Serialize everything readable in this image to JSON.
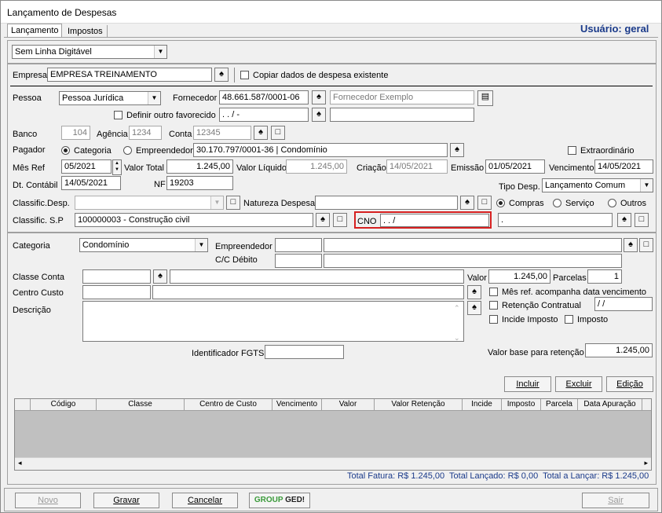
{
  "window": {
    "title": "Lançamento de Despesas"
  },
  "tabs": [
    {
      "label": "Lançamento"
    },
    {
      "label": "Impostos"
    }
  ],
  "user_label": "Usuário: geral",
  "line_type": "Sem Linha Digitável",
  "empresa": {
    "label": "Empresa",
    "value": "EMPRESA TREINAMENTO",
    "copy_label": "Copiar dados de despesa existente"
  },
  "pessoa": {
    "label": "Pessoa",
    "value": "Pessoa Jurídica"
  },
  "fornecedor": {
    "label": "Fornecedor",
    "cnpj": "48.661.587/0001-06",
    "placeholder": "Fornecedor Exemplo"
  },
  "outro_favorecido": {
    "label": "Definir outro favorecido",
    "value": " .   .   /   -"
  },
  "banco": {
    "label": "Banco",
    "value": "104"
  },
  "agencia": {
    "label": "Agência",
    "value": "1234"
  },
  "conta": {
    "label": "Conta",
    "value": "12345"
  },
  "pagador": {
    "label": "Pagador",
    "opt1": "Categoria",
    "opt2": "Empreendedor",
    "value": "30.170.797/0001-36 | Condomínio"
  },
  "extraordinario": {
    "label": "Extraordinário"
  },
  "mes_ref": {
    "label": "Mês Ref",
    "value": "05/2021"
  },
  "valor_total": {
    "label": "Valor Total",
    "value": "1.245,00"
  },
  "valor_liquido": {
    "label": "Valor Líquido",
    "value": "1.245,00"
  },
  "criacao": {
    "label": "Criação",
    "value": "14/05/2021"
  },
  "emissao": {
    "label": "Emissão",
    "value": "01/05/2021"
  },
  "vencimento": {
    "label": "Vencimento",
    "value": "14/05/2021"
  },
  "dt_contabil": {
    "label": "Dt. Contábil",
    "value": "14/05/2021"
  },
  "nf": {
    "label": "NF",
    "value": "19203"
  },
  "tipo_desp": {
    "label": "Tipo Desp.",
    "value": "Lançamento Comum"
  },
  "classif_desp": {
    "label": "Classific.Desp."
  },
  "natureza": {
    "label": "Natureza Despesa",
    "opt1": "Compras",
    "opt2": "Serviço",
    "opt3": "Outros"
  },
  "classif_sp": {
    "label": "Classific. S.P",
    "value": "100000003 - Construção civil"
  },
  "cno": {
    "label": "CNO",
    "value": " .   .      /"
  },
  "dot_field": ".",
  "categoria": {
    "label": "Categoria",
    "value": "Condomínio"
  },
  "empreendedor_label": "Empreendedor",
  "cc_debito_label": "C/C Débito",
  "classe_conta_label": "Classe Conta",
  "valor": {
    "label": "Valor",
    "value": "1.245,00"
  },
  "parcelas": {
    "label": "Parcelas",
    "value": "1"
  },
  "centro_custo_label": "Centro Custo",
  "mes_ref_acompanha": "Mês ref. acompanha data vencimento",
  "retencao": {
    "label": "Retenção Contratual",
    "value": " / /"
  },
  "incide_imposto": "Incide Imposto",
  "imposto": "Imposto",
  "descricao_label": "Descrição",
  "fgts_label": "Identificador FGTS",
  "valor_base": {
    "label": "Valor base para retenção",
    "value": "1.245,00"
  },
  "actions": {
    "incluir": "Incluir",
    "excluir": "Excluir",
    "edicao": "Edição"
  },
  "grid_columns": [
    "Código",
    "Classe",
    "Centro de Custo",
    "Vencimento",
    "Valor",
    "Valor Retenção",
    "Incide",
    "Imposto",
    "Parcela",
    "Data Apuração"
  ],
  "totals": "Total Fatura: R$ 1.245,00  Total Lançado: R$ 0,00  Total a Lançar: R$ 1.245,00",
  "footer": {
    "novo": "Novo",
    "gravar": "Gravar",
    "cancelar": "Cancelar",
    "brand1": "GROUP",
    "brand2": "GED!",
    "sair": "Sair"
  }
}
